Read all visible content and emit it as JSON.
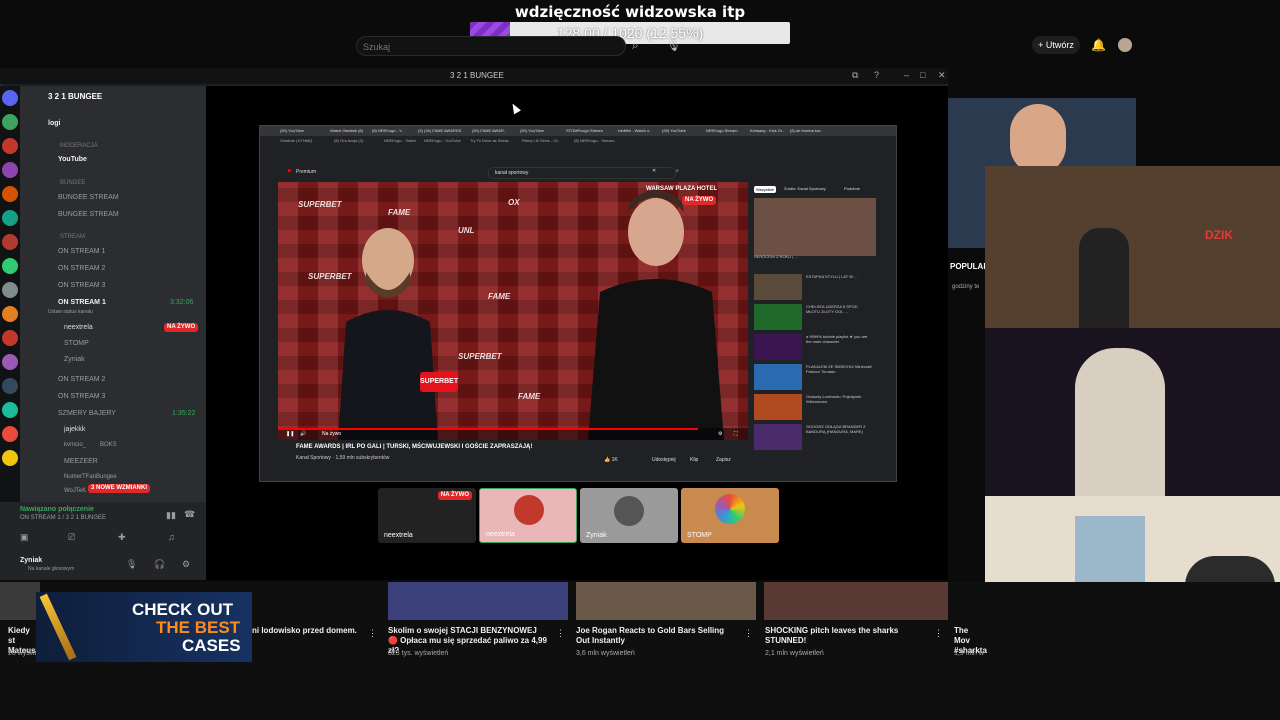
{
  "donation_goal": {
    "title": "wdzięczność widzowska itp",
    "progress_text": "128.00 / 1020 (12.55%)",
    "progress_pct": 12.55,
    "fill_color": "#8a3ad6"
  },
  "yt_top": {
    "search_placeholder": "Szukaj",
    "create_label": "Utwórz"
  },
  "discord": {
    "window_title": "3 2 1 BUNGEE",
    "server_name": "3 2 1 BUNGEE",
    "channels": {
      "logi": "logi",
      "moderacja": "MODERACJA",
      "youtube": "YouTube",
      "bungee_cat": "BUNGEE",
      "bungee_stream1": "BUNGEE STREAM",
      "bungee_stream2": "BUNGEE STREAM",
      "stream_cat": "STREAM",
      "on_stream_1a": "ON STREAM 1",
      "on_stream_2a": "ON STREAM 2",
      "on_stream_3a": "ON STREAM 3",
      "on_stream_1b": "ON STREAM 1",
      "status_hint": "Ustaw status kanału",
      "on_stream_2b": "ON STREAM 2",
      "on_stream_3b": "ON STREAM 3",
      "szmery": "SZMERY BAJERY",
      "timer1": "3:32:06",
      "timer2": "1:35:22"
    },
    "members_stream": [
      "neextrela",
      "STOMP",
      "Zyniak"
    ],
    "members_szmery": [
      "jajekkk",
      "kvmcio_",
      "MEEZEER",
      "NumerTFanBungee",
      "WoJTeK"
    ],
    "live_label": "NA ŻYWO",
    "boks_label": "BOKS",
    "mentions_badge": "3 NOWE WZMIANKI",
    "voice_connected": "Nawiązano połączenie",
    "voice_channel": "ON STREAM 1 / 3 2 1 BUNGEE",
    "user_name": "Zyniak",
    "user_status": "Na kanale głosowym"
  },
  "browser": {
    "tabs": [
      "(20) YouTube",
      "Watch Ostatnik (8)",
      "(8) NEEKogo - Y..",
      "(3) (34) FAME AWARDS",
      "(20) FAME AWAR..",
      "(20) YouTube",
      "STOMPcogo Stream",
      "rdnMini - Watch o..",
      "(29) YouTube",
      "NEEKogo Stream",
      "Kvbaaay - Kick Gr..",
      "(8) air bomba kur.."
    ],
    "url": "Ostatnie (10 NMQ ..",
    "bookmarks": [
      "Ostatnie (10 NMQ ..",
      "(8) Gra twoja (3) ..",
      "NEEKogo - Twitch",
      "NEEKogo - YouTube",
      "Try To Drive as Streat..",
      "Rrkey Li0 Skins - Ot..",
      "(8) NEEKogo - Stream.."
    ],
    "yt_logo": "Premium",
    "yt_search": "kanał sportowy",
    "video_title": "FAME AWARDS | IRL PO GALI | TURSKI, MŚCIWUJEWSKI I GOŚCIE ZAPRASZAJĄ!",
    "channel": "Kanał Sportowy",
    "subs": "1,59 mln subskrybentów",
    "overlay_title": "WARSAW PLAZA HOTEL",
    "overlay_live": "NA ŻYWO",
    "filters": [
      "Wszystkie",
      "Źródło: Kanał Sportowy",
      "Podobne"
    ],
    "related": [
      "SKRÓCENI Z ROKU | ...",
      "ESTAPKA STYLU | LAT W ...",
      "CHELSEA UDERZA 5 SPOD MŁOTU ZŁOTY GOL ...",
      "a 9999% bubble playlist ★ you are the main character",
      "PLAKALEM ZE ŚMIECHU! Minecraft Parkour Tornado",
      "Gwiazdy Lombardu: Pojedynek Wieżowców",
      "GOOGRZ ODŁĄGA BRANDER Z BANDURĄ (HANDURA, MARK)"
    ],
    "wall_words": [
      "SUPERBET",
      "FAME",
      "UNL",
      "OX",
      "SUPERBET",
      "FAME",
      "SUPERBET",
      "FAME"
    ],
    "mic_label": "SUPERBET",
    "control_time": "Na żywo",
    "likes": "1K",
    "actions": [
      "Udostępnij",
      "Klip",
      "Zapisz"
    ]
  },
  "participants": [
    {
      "name": "neextrela",
      "live": true,
      "bg": "#222222"
    },
    {
      "name": "neextrela",
      "live": false,
      "bg": "#e9b7b7"
    },
    {
      "name": "Zyniak",
      "live": false,
      "bg": "#9a9a9a"
    },
    {
      "name": "STOMP",
      "live": false,
      "bg": "#c98a4f"
    }
  ],
  "webcams": {
    "popular_label": "POPULAR",
    "hours_label": "godziny te",
    "brand": "DZIK"
  },
  "bottom_videos": [
    {
      "title": "Kiedy st Mateusz",
      "meta": "26 wyświ"
    },
    {
      "title": "ni lodowisko przed domem.",
      "meta": ""
    },
    {
      "title": "Skolim o swojej STACJI BENZYNOWEJ 🔴 Opłaca mu się sprzedać paliwo za 4,99 zł?",
      "meta": "823 tys. wyświetleń"
    },
    {
      "title": "Joe Rogan Reacts to Gold Bars Selling Out Instantly",
      "meta": "3,6 mln wyświetleń"
    },
    {
      "title": "SHOCKING pitch leaves the sharks STUNNED!",
      "meta": "2,1 mln wyświetleń"
    },
    {
      "title": "The Mov #sharkta",
      "meta": "1,9 mln w"
    }
  ],
  "ad": {
    "line1": "CHECK OUT",
    "line2": "THE BEST",
    "line3": "CASES"
  }
}
